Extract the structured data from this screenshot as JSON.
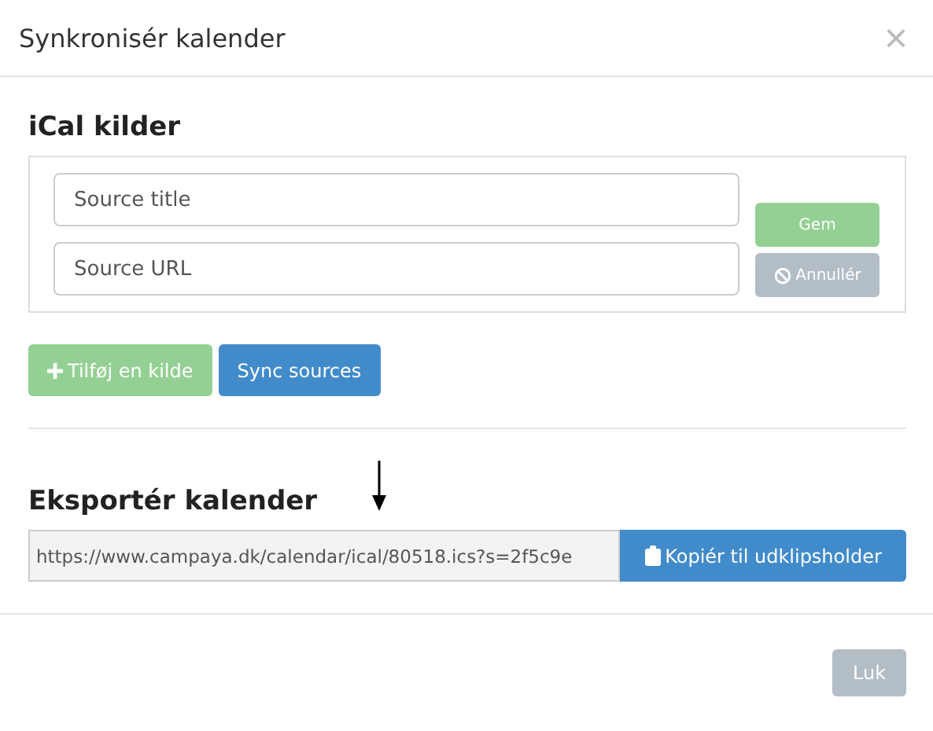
{
  "dialog": {
    "title": "Synkronisér kalender",
    "close": "×"
  },
  "ical": {
    "heading": "iCal kilder",
    "fields": [
      {
        "placeholder": "Source title"
      },
      {
        "placeholder": "Source URL"
      }
    ],
    "save": {
      "label": "Gem",
      "disabled": true
    },
    "cancel": {
      "label": "Annullér",
      "disabled": true
    },
    "add": {
      "label": "Tilføj en kilde",
      "disabled": true
    },
    "sync": {
      "label": "Sync sources",
      "disabled": false
    }
  },
  "export": {
    "heading": "Eksportér kalender",
    "url": "https://www.campaya.dk/calendar/ical/80518.ics?s=2f5c9e",
    "copy": "Kopiér til udklipsholder"
  },
  "footer": {
    "close": {
      "label": "Luk",
      "disabled": true
    }
  }
}
